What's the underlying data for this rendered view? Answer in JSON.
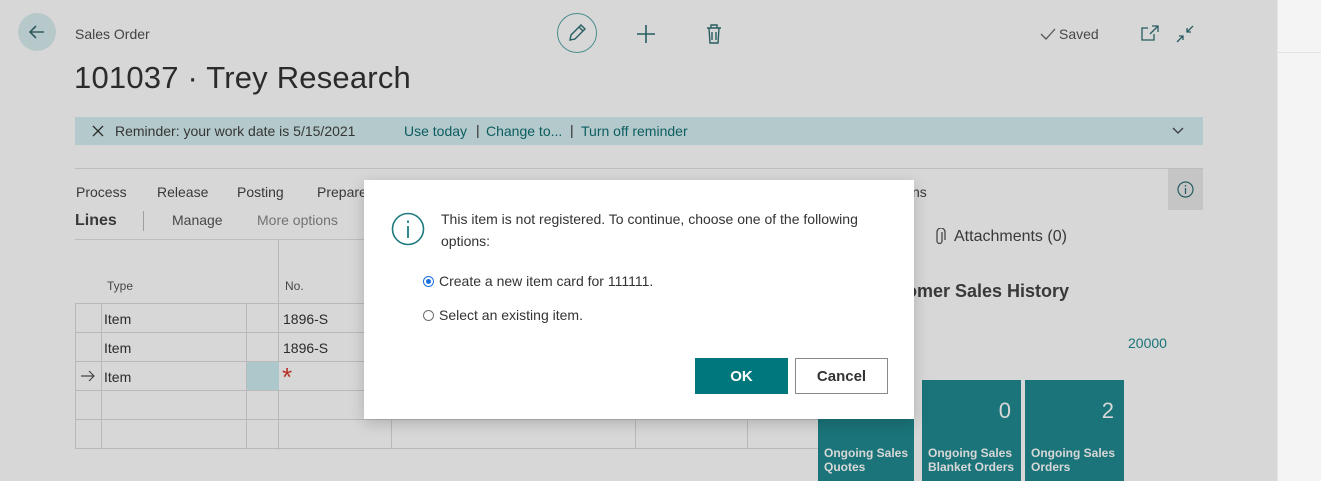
{
  "header": {
    "caption": "Sales Order",
    "title": "101037 · Trey Research",
    "status": "Saved"
  },
  "banner": {
    "text": "Reminder: your work date is 5/15/2021",
    "use_today": "Use today",
    "change_to": "Change to...",
    "turn_off": "Turn off reminder",
    "sep": "|"
  },
  "actions": {
    "tabs": [
      "Process",
      "Release",
      "Posting",
      "Prepare"
    ],
    "tab_suffix": "ns"
  },
  "lines": {
    "title": "Lines",
    "manage": "Manage",
    "more_options": "More options",
    "columns": [
      "Type",
      "No."
    ],
    "rows": [
      {
        "type": "Item",
        "no": "1896-S"
      },
      {
        "type": "Item",
        "no": "1896-S"
      },
      {
        "type": "Item",
        "no": "*"
      }
    ]
  },
  "factbox": {
    "attachments": "Attachments (0)",
    "history_title": "tomer Sales History",
    "customer_no": "20000",
    "tiles": [
      {
        "value": "",
        "label_1": "Ongoing Sales",
        "label_2": "Quotes"
      },
      {
        "value": "0",
        "label_1": "Ongoing Sales",
        "label_2": "Blanket Orders"
      },
      {
        "value": "2",
        "label_1": "Ongoing Sales",
        "label_2": "Orders"
      }
    ]
  },
  "dialog": {
    "message": "This item is not registered. To continue, choose one of the following options:",
    "options": [
      {
        "label": "Create a new item card for 111111.",
        "selected": true
      },
      {
        "label": "Select an existing item.",
        "selected": false
      }
    ],
    "ok": "OK",
    "cancel": "Cancel"
  },
  "colors": {
    "accent": "#00777d",
    "banner": "#d6eff1",
    "tile": "#1f8a90",
    "radio": "#1a6fe0",
    "required": "#d83b2b"
  },
  "icons": [
    "back-arrow-icon",
    "pencil-icon",
    "plus-icon",
    "trash-icon",
    "check-icon",
    "popout-icon",
    "collapse-icon",
    "close-icon",
    "chevron-down-icon",
    "info-icon",
    "paperclip-icon",
    "arrow-right-icon"
  ]
}
